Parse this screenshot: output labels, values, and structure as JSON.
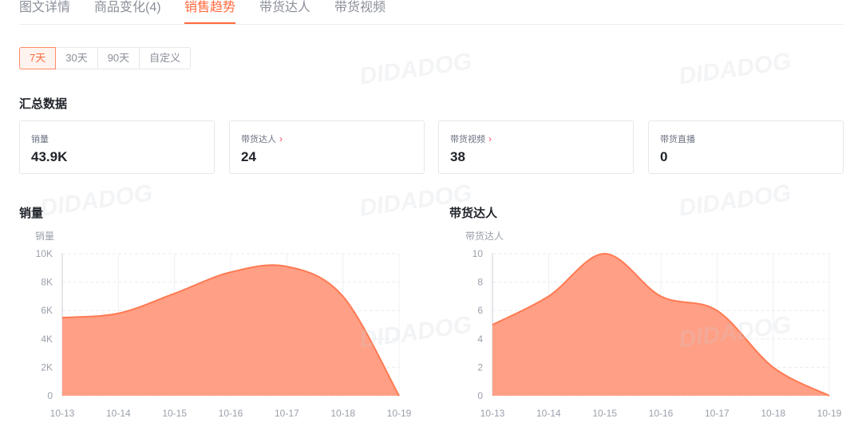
{
  "tabs": [
    {
      "label": "图文详情",
      "active": false
    },
    {
      "label": "商品变化(4)",
      "active": false
    },
    {
      "label": "销售趋势",
      "active": true
    },
    {
      "label": "带货达人",
      "active": false
    },
    {
      "label": "带货视频",
      "active": false
    }
  ],
  "range_buttons": [
    {
      "label": "7天",
      "active": true
    },
    {
      "label": "30天",
      "active": false
    },
    {
      "label": "90天",
      "active": false
    },
    {
      "label": "自定义",
      "active": false
    }
  ],
  "summary": {
    "title": "汇总数据",
    "cards": [
      {
        "label": "销量",
        "value": "43.9K",
        "has_arrow": false
      },
      {
        "label": "带货达人",
        "value": "24",
        "has_arrow": true
      },
      {
        "label": "带货视频",
        "value": "38",
        "has_arrow": true
      },
      {
        "label": "带货直播",
        "value": "0",
        "has_arrow": false
      }
    ]
  },
  "watermark": "DIDADOG",
  "colors": {
    "accent": "#ff6a3d",
    "area_fill": "#ff9a7e",
    "area_line": "#ff7a52",
    "arrow": "#ff4d6a"
  },
  "chart_data": [
    {
      "type": "area",
      "title": "销量",
      "ylabel": "销量",
      "x": [
        "10-13",
        "10-14",
        "10-15",
        "10-16",
        "10-17",
        "10-18",
        "10-19"
      ],
      "y_ticks": [
        "0",
        "2K",
        "4K",
        "6K",
        "8K",
        "10K"
      ],
      "ylim": [
        0,
        10000
      ],
      "values": [
        5500,
        5800,
        7200,
        8700,
        9100,
        7000,
        0
      ],
      "grid": true
    },
    {
      "type": "area",
      "title": "带货达人",
      "ylabel": "带货达人",
      "x": [
        "10-13",
        "10-14",
        "10-15",
        "10-16",
        "10-17",
        "10-18",
        "10-19"
      ],
      "y_ticks": [
        "0",
        "2",
        "4",
        "6",
        "8",
        "10"
      ],
      "ylim": [
        0,
        10
      ],
      "values": [
        5,
        7,
        10,
        7,
        6,
        2,
        0
      ],
      "grid": true
    }
  ]
}
